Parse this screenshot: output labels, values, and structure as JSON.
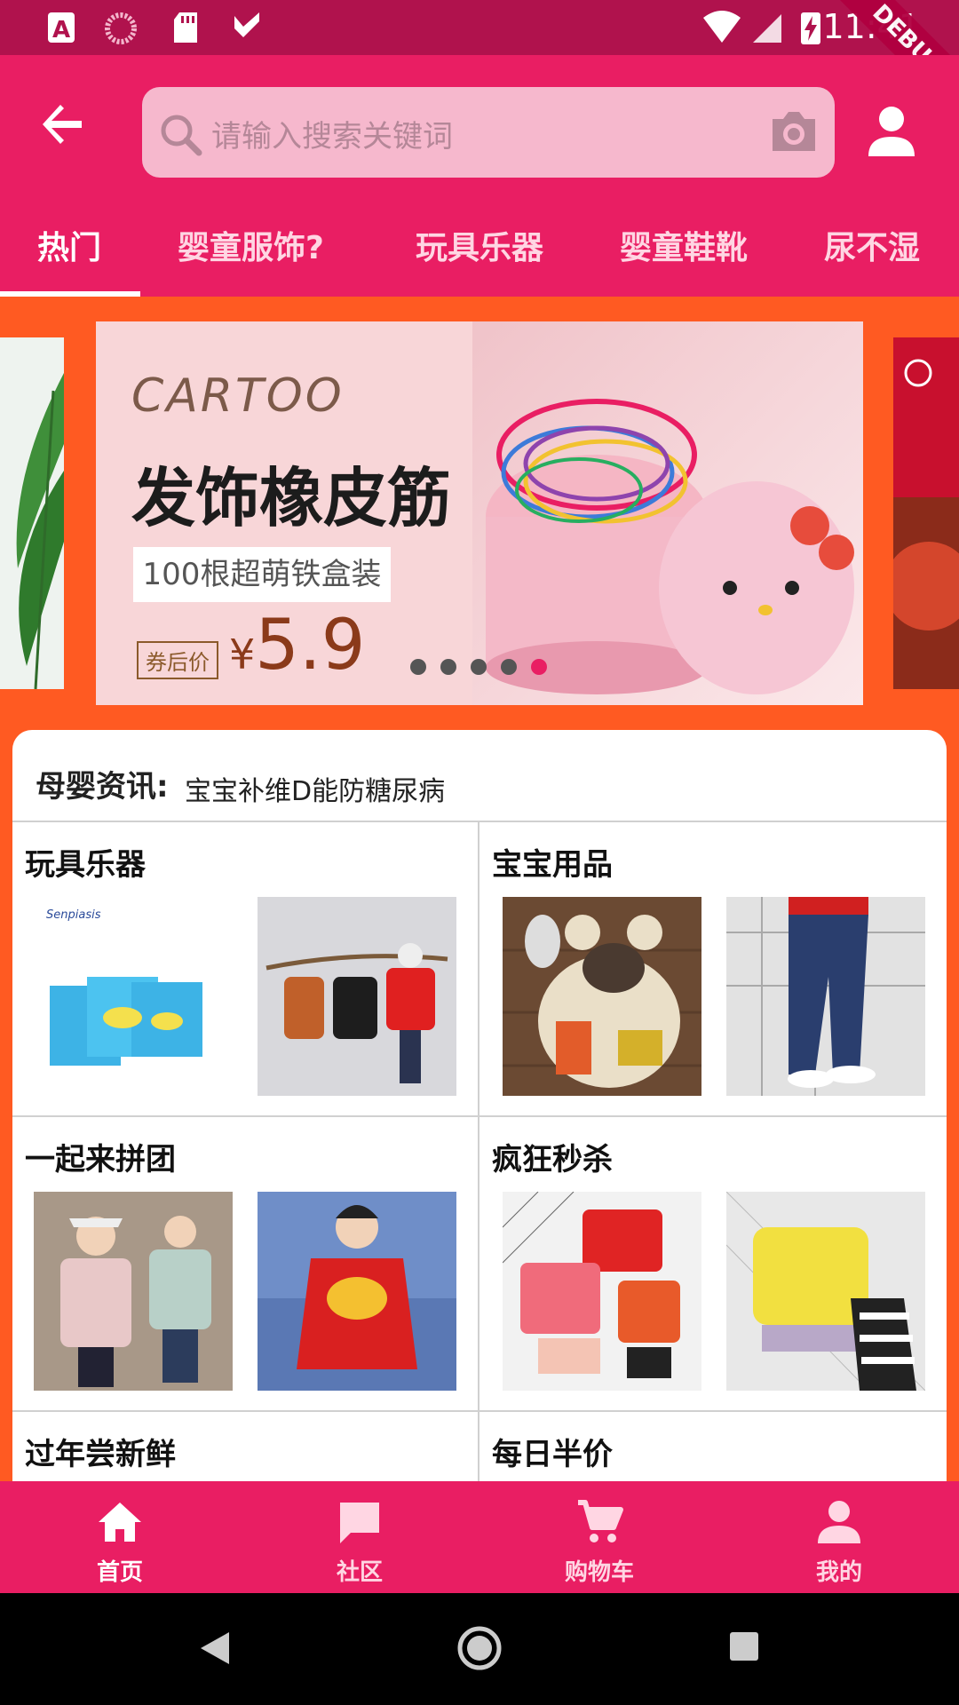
{
  "status_bar": {
    "time": "11:41"
  },
  "debug_ribbon": "DEBUG",
  "search": {
    "placeholder": "请输入搜索关键词"
  },
  "tabs": [
    {
      "label": "热门",
      "active": true
    },
    {
      "label": "婴童服饰?"
    },
    {
      "label": "玩具乐器"
    },
    {
      "label": "婴童鞋靴"
    },
    {
      "label": "尿不湿"
    }
  ],
  "banner": {
    "brand": "CARTOO",
    "title": "发饰橡皮筋",
    "tag": "100根超萌铁盒装",
    "price_label": "券后价",
    "currency": "¥",
    "price": "5.9",
    "page_count": 5,
    "active_page": 5
  },
  "news": {
    "label": "母婴资讯:",
    "text": "宝宝补维D能防糖尿病"
  },
  "sections": [
    {
      "title": "玩具乐器"
    },
    {
      "title": "宝宝用品"
    },
    {
      "title": "一起来拼团"
    },
    {
      "title": "疯狂秒杀"
    },
    {
      "title": "过年尝新鲜"
    },
    {
      "title": "每日半价"
    }
  ],
  "bottom_nav": [
    {
      "label": "首页",
      "icon": "home-icon",
      "active": true
    },
    {
      "label": "社区",
      "icon": "chat-icon"
    },
    {
      "label": "购物车",
      "icon": "cart-icon"
    },
    {
      "label": "我的",
      "icon": "person-icon"
    }
  ],
  "colors": {
    "primary": "#e91e63",
    "status_bar": "#b0124d",
    "accent_bg": "#ff5a22",
    "inactive_tab": "#ffd6e3"
  }
}
